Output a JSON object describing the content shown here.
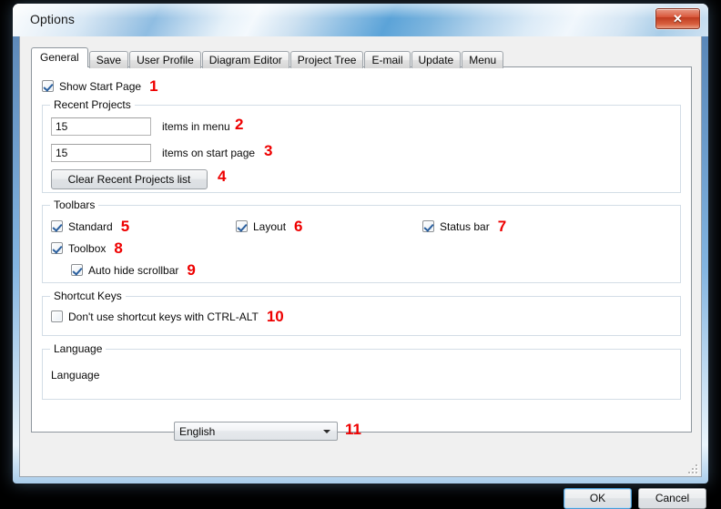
{
  "window": {
    "title": "Options",
    "close_label": "✕"
  },
  "tabs": [
    {
      "label": "General",
      "active": true
    },
    {
      "label": "Save",
      "active": false
    },
    {
      "label": "User Profile",
      "active": false
    },
    {
      "label": "Diagram Editor",
      "active": false
    },
    {
      "label": "Project Tree",
      "active": false
    },
    {
      "label": "E-mail",
      "active": false
    },
    {
      "label": "Update",
      "active": false
    },
    {
      "label": "Menu",
      "active": false
    }
  ],
  "general": {
    "show_start_page": {
      "label": "Show Start Page",
      "checked": true,
      "annotation": "1"
    },
    "recent_projects": {
      "title": "Recent Projects",
      "items_in_menu": {
        "value": "15",
        "label": "items in menu",
        "annotation": "2"
      },
      "items_on_start_page": {
        "value": "15",
        "label": "items on start page",
        "annotation": "3"
      },
      "clear_button": {
        "label": "Clear Recent Projects list",
        "annotation": "4"
      }
    },
    "toolbars": {
      "title": "Toolbars",
      "options": [
        {
          "label": "Standard",
          "checked": true,
          "annotation": "5"
        },
        {
          "label": "Layout",
          "checked": true,
          "annotation": "6"
        },
        {
          "label": "Status bar",
          "checked": true,
          "annotation": "7"
        },
        {
          "label": "Toolbox",
          "checked": true,
          "annotation": "8"
        },
        {
          "label": "Auto hide scrollbar",
          "checked": true,
          "annotation": "9"
        }
      ]
    },
    "shortcut_keys": {
      "title": "Shortcut Keys",
      "option": {
        "label": "Don't use shortcut keys with CTRL-ALT",
        "checked": false,
        "annotation": "10"
      }
    },
    "language": {
      "title": "Language",
      "field_label": "Language",
      "selected": "English",
      "annotation": "11"
    }
  },
  "footer": {
    "ok_label": "OK",
    "cancel_label": "Cancel"
  },
  "colors": {
    "annotation_red": "#ee0000",
    "accent_blue": "#4a9bd4",
    "close_red": "#c03c21"
  }
}
